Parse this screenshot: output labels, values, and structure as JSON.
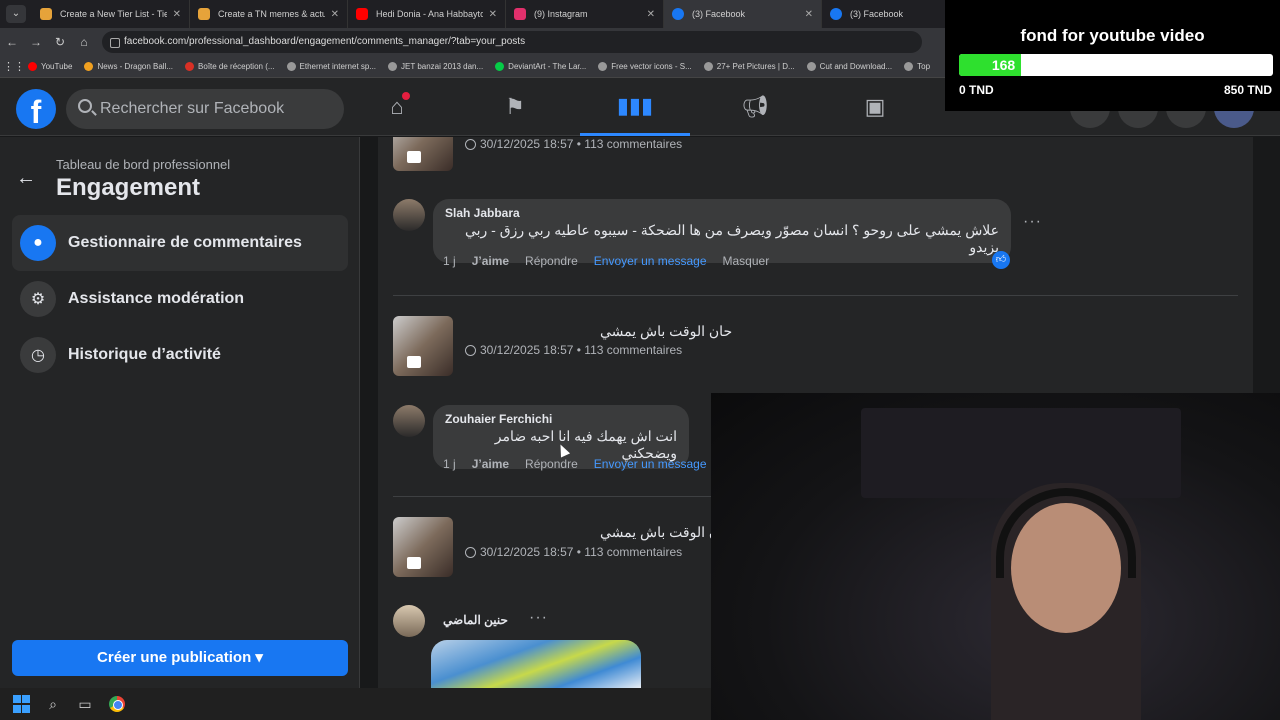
{
  "browser": {
    "tabs": [
      {
        "label": "Create a New Tier List - TierMaker",
        "color": "#e6a33a"
      },
      {
        "label": "Create a TN memes & actu 2025",
        "color": "#e6a33a"
      },
      {
        "label": "Hedi Donia - Ana Habbaytou (",
        "color": "#ff0000"
      },
      {
        "label": "(9) Instagram",
        "color": "#e1306c"
      },
      {
        "label": "(3) Facebook",
        "color": "#1877f2"
      },
      {
        "label": "(3) Facebook",
        "color": "#1877f2"
      }
    ],
    "url": "facebook.com/professional_dashboard/engagement/comments_manager/?tab=your_posts",
    "bookmarks": [
      {
        "label": "YouTube",
        "color": "#ff0000"
      },
      {
        "label": "News - Dragon Ball...",
        "color": "#f0a020"
      },
      {
        "label": "Boîte de réception (...",
        "color": "#d93025"
      },
      {
        "label": "Ethernet internet sp...",
        "color": "#999999"
      },
      {
        "label": "JET banzai 2013 dan...",
        "color": "#999999"
      },
      {
        "label": "DeviantArt - The Lar...",
        "color": "#05cc47"
      },
      {
        "label": "Free vector icons - S...",
        "color": "#999999"
      },
      {
        "label": "27+ Pet Pictures | D...",
        "color": "#999999"
      },
      {
        "label": "Cut and Download...",
        "color": "#999999"
      },
      {
        "label": "Top",
        "color": "#999999"
      }
    ]
  },
  "overlay": {
    "title": "fond for youtube video",
    "current": "168",
    "progress": 0.198,
    "min_label": "0 TND",
    "max_label": "850 TND"
  },
  "fb": {
    "search_placeholder": "Rechercher sur Facebook"
  },
  "sidebar": {
    "subtitle": "Tableau de bord professionnel",
    "title": "Engagement",
    "items": [
      {
        "label": "Gestionnaire de commentaires"
      },
      {
        "label": "Assistance modération"
      },
      {
        "label": "Historique d’activité"
      }
    ],
    "create_label": "Créer une publication"
  },
  "posts": [
    {
      "meta": "30/12/2025 18:57 • 113 commentaires",
      "text": ""
    },
    {
      "meta": "30/12/2025 18:57 • 113 commentaires",
      "text": "حان الوقت باش يمشي"
    },
    {
      "meta": "30/12/2025 18:57 • 113 commentaires",
      "text": "حان الوقت باش يمشي"
    }
  ],
  "comments": [
    {
      "author": "Slah Jabbara",
      "text": "علاش يمشي على روحو ؟ انسان مصوّر ويصرف من ها الضحكة - سيبوه عاطيه ربي رزق - ربي يزيدو",
      "time": "1 j",
      "like": "J’aime",
      "reply": "Répondre",
      "message": "Envoyer un message",
      "hide": "Masquer"
    },
    {
      "author": "Zouhaier Ferchichi",
      "text": "انت اش يهمك فيه انا احبه ضامر ويضحكني",
      "time": "1 j",
      "like": "J’aime",
      "reply": "Répondre",
      "message": "Envoyer un message"
    },
    {
      "author": "حنين الماضي"
    }
  ]
}
